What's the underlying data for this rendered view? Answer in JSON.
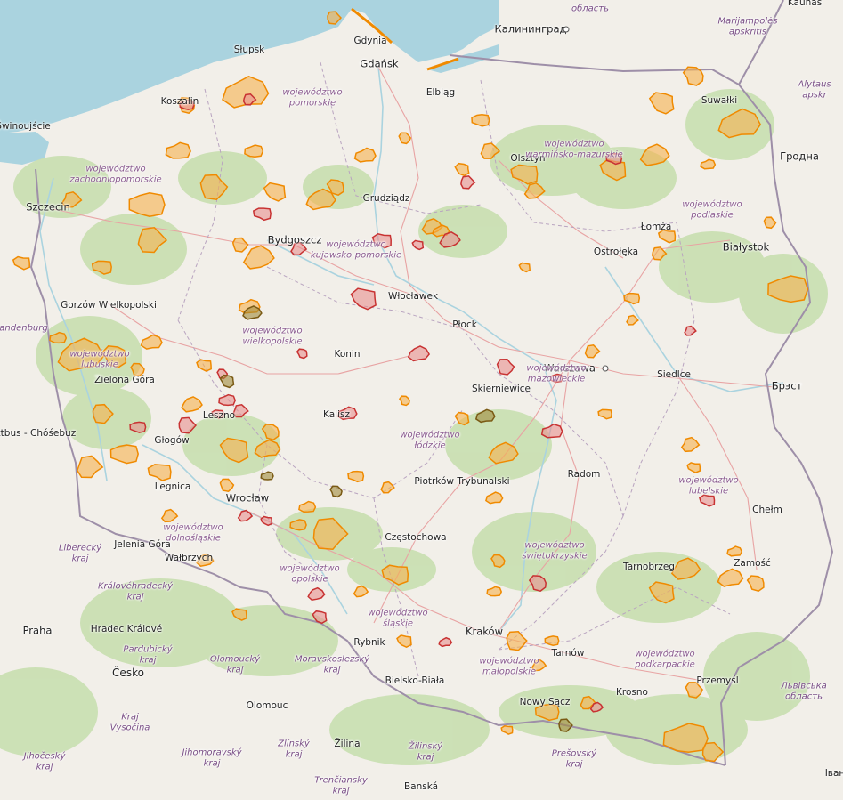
{
  "map": {
    "colors": {
      "land": "#f2efe9",
      "sea": "#aad3df",
      "forest": "#add19e",
      "border": "#9e8fa8",
      "road": "#e8a3a3",
      "protected_fill_orange": "#f5b04f",
      "protected_stroke_orange": "#f08a00",
      "protected_fill_red": "#e88f8f",
      "protected_stroke_red": "#c83232",
      "protected_fill_brown": "#a08a3c",
      "protected_stroke_brown": "#7a5a14"
    },
    "cities": [
      {
        "name": "Słupsk",
        "dot": false
      },
      {
        "name": "Gdynia",
        "dot": false
      },
      {
        "name": "Gdańsk",
        "dot": false
      },
      {
        "name": "Калининград",
        "dot": true
      },
      {
        "name": "Elbląg",
        "dot": false
      },
      {
        "name": "Koszalin",
        "dot": false
      },
      {
        "name": "Świnoujście",
        "dot": false
      },
      {
        "name": "Szczecin",
        "dot": false
      },
      {
        "name": "Grudziądz",
        "dot": false
      },
      {
        "name": "Olsztyn",
        "dot": false
      },
      {
        "name": "Suwałki",
        "dot": false
      },
      {
        "name": "Гродна",
        "dot": false
      },
      {
        "name": "Kaunas",
        "dot": false
      },
      {
        "name": "Bydgoszcz",
        "dot": false
      },
      {
        "name": "Łomża",
        "dot": false
      },
      {
        "name": "Ostrołęka",
        "dot": false
      },
      {
        "name": "Białystok",
        "dot": false
      },
      {
        "name": "Gorzów Wielkopolski",
        "dot": false
      },
      {
        "name": "Włocławek",
        "dot": false
      },
      {
        "name": "Płock",
        "dot": false
      },
      {
        "name": "Konin",
        "dot": false
      },
      {
        "name": "Warszawa",
        "dot": true
      },
      {
        "name": "Siedlce",
        "dot": false
      },
      {
        "name": "Брэст",
        "dot": false
      },
      {
        "name": "Zielona Góra",
        "dot": false
      },
      {
        "name": "Skierniewice",
        "dot": false
      },
      {
        "name": "Kalisz",
        "dot": false
      },
      {
        "name": "Leszno",
        "dot": false
      },
      {
        "name": "Cottbus - Chóśebuz",
        "dot": false
      },
      {
        "name": "Głogów",
        "dot": false
      },
      {
        "name": "Piotrków Trybunalski",
        "dot": false
      },
      {
        "name": "Radom",
        "dot": false
      },
      {
        "name": "Legnica",
        "dot": false
      },
      {
        "name": "Wrocław",
        "dot": false
      },
      {
        "name": "Chełm",
        "dot": false
      },
      {
        "name": "Częstochowa",
        "dot": false
      },
      {
        "name": "Jelenia Góra",
        "dot": false
      },
      {
        "name": "Wałbrzych",
        "dot": false
      },
      {
        "name": "Tarnobrzeg",
        "dot": false
      },
      {
        "name": "Zamość",
        "dot": false
      },
      {
        "name": "Kraków",
        "dot": false
      },
      {
        "name": "Praha",
        "dot": false
      },
      {
        "name": "Hradec Králové",
        "dot": false
      },
      {
        "name": "Rybnik",
        "dot": false
      },
      {
        "name": "Tarnów",
        "dot": false
      },
      {
        "name": "Przemyśl",
        "dot": false
      },
      {
        "name": "Bielsko-Biała",
        "dot": false
      },
      {
        "name": "Krosno",
        "dot": false
      },
      {
        "name": "Olomouc",
        "dot": false
      },
      {
        "name": "Nowy Sącz",
        "dot": false
      },
      {
        "name": "Žilina",
        "dot": false
      },
      {
        "name": "Banská",
        "dot": false
      },
      {
        "name": "Iван",
        "dot": false
      }
    ],
    "regions": [
      "województwo pomorskie",
      "województwo zachodniopomorskie",
      "województwo warmińsko-mazurskie",
      "województwo podlaskie",
      "województwo kujawsko-pomorskie",
      "województwo wielkopolskie",
      "województwo lubuskie",
      "województwo łódzkie",
      "województwo mazowieckie",
      "województwo lubelskie",
      "województwo dolnośląskie",
      "województwo świętokrzyskie",
      "województwo opolskie",
      "województwo śląskie",
      "województwo małopolskie",
      "województwo podkarpackie"
    ],
    "foreign_labels": [
      "Marijampolės apskritis",
      "Alytaus apskr",
      "область",
      "Liberecký kraj",
      "Královéhradecký kraj",
      "Pardubický kraj",
      "Olomoucký kraj",
      "Moravskoslezský kraj",
      "Kraj Vysočina",
      "Jihočeský kraj",
      "Jihomoravský kraj",
      "Zlínský kraj",
      "Žilinský kraj",
      "Prešovský kraj",
      "Trenčiansky kraj",
      "Львівська область",
      "Brandenburg"
    ],
    "country_labels": [
      "Česko"
    ]
  }
}
